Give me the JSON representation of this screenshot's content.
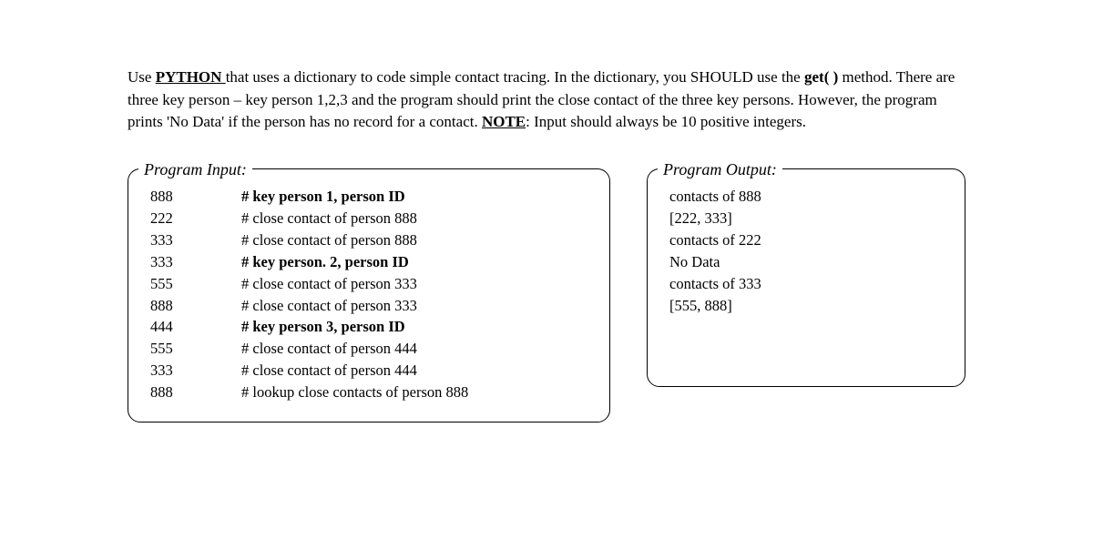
{
  "intro": {
    "seg1": "Use ",
    "python": "PYTHON ",
    "seg2": "that uses a dictionary to code simple contact tracing. In the dictionary, you SHOULD use the ",
    "get": "get( )",
    "seg3": " method. There are three key person – key person 1,2,3 and the program should print the close contact of the three key persons. However, the program prints 'No Data' if the person has no record for a contact. ",
    "note": "NOTE",
    "seg4": ": Input should always be 10 positive integers."
  },
  "legends": {
    "input": "Program Input:",
    "output": "Program Output:"
  },
  "input_rows": [
    {
      "num": "888",
      "comment": "# key person 1, person ID",
      "bold": true
    },
    {
      "num": "222",
      "comment": "# close contact of person 888",
      "bold": false
    },
    {
      "num": "333",
      "comment": "# close contact of person 888",
      "bold": false
    },
    {
      "num": "333",
      "comment": "# key person.  2, person ID",
      "bold": true
    },
    {
      "num": "555",
      "comment": "# close contact of person 333",
      "bold": false
    },
    {
      "num": "888",
      "comment": "# close contact of person 333",
      "bold": false
    },
    {
      "num": "444",
      "comment": "# key person 3, person ID",
      "bold": true
    },
    {
      "num": "555",
      "comment": "# close contact of person 444",
      "bold": false
    },
    {
      "num": "333",
      "comment": "# close contact of person 444",
      "bold": false
    },
    {
      "num": "888",
      "comment": "# lookup close contacts of person 888",
      "bold": false
    }
  ],
  "output_lines": [
    "contacts of 888",
    "[222, 333]",
    "contacts of 222",
    "No Data",
    "contacts of 333",
    "[555, 888]"
  ]
}
